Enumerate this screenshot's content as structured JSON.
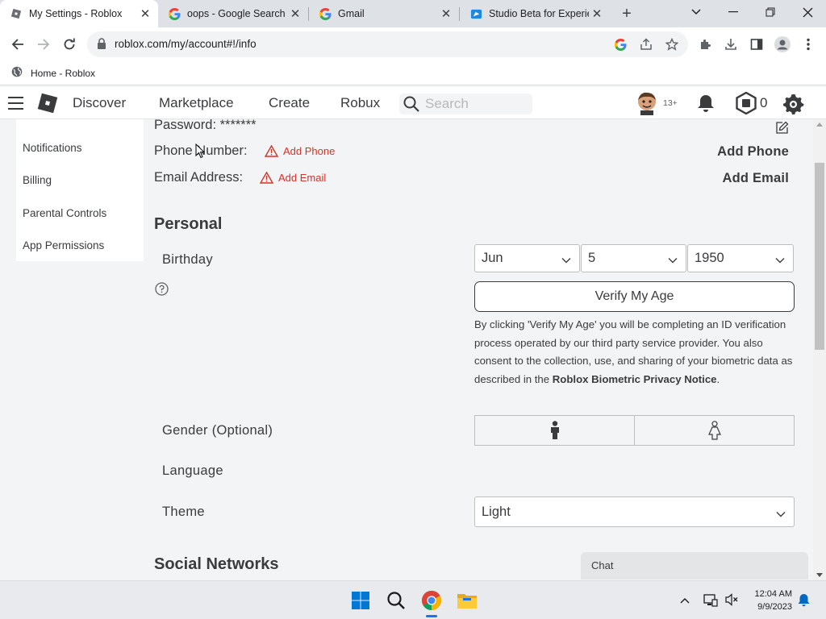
{
  "browser": {
    "tabs": [
      {
        "title": "My Settings - Roblox",
        "favicon": "roblox-favicon",
        "active": true
      },
      {
        "title": "oops - Google Search",
        "favicon": "google-favicon",
        "active": false
      },
      {
        "title": "Gmail",
        "favicon": "google-favicon",
        "active": false
      },
      {
        "title": "Studio Beta for Experie",
        "favicon": "roblox-studio-favicon",
        "active": false
      }
    ],
    "url": "roblox.com/my/account#!/info",
    "bookmark": "Home - Roblox"
  },
  "nav": {
    "links": [
      "Discover",
      "Marketplace",
      "Create",
      "Robux"
    ],
    "search_placeholder": "Search",
    "age_badge": "13+",
    "robux_balance": "0"
  },
  "sidebar": {
    "items": [
      "Notifications",
      "Billing",
      "Parental Controls",
      "App Permissions"
    ]
  },
  "account": {
    "password_label": "Password:",
    "password_value": "*******",
    "phone_label": "Phone Number:",
    "phone_warning": "Add Phone",
    "phone_action": "Add Phone",
    "email_label": "Email Address:",
    "email_warning": "Add Email",
    "email_action": "Add Email"
  },
  "personal": {
    "heading": "Personal",
    "birthday_label": "Birthday",
    "birth_month": "Jun",
    "birth_day": "5",
    "birth_year": "1950",
    "verify_button": "Verify My Age",
    "notice_text": "By clicking 'Verify My Age' you will be completing an ID verification process operated by our third party service provider. You also consent to the collection, use, and sharing of your biometric data as described in the ",
    "notice_link": "Roblox Biometric Privacy Notice",
    "notice_end": ".",
    "gender_label": "Gender (Optional)",
    "language_label": "Language",
    "theme_label": "Theme",
    "theme_value": "Light"
  },
  "social": {
    "heading": "Social Networks"
  },
  "chat": {
    "label": "Chat"
  },
  "taskbar": {
    "time": "12:04 AM",
    "date": "9/9/2023"
  },
  "colors": {
    "warning": "#d63228",
    "page_bg": "#f2f4f5",
    "text": "#393b3d",
    "chrome_blue": "#1a73e8"
  }
}
